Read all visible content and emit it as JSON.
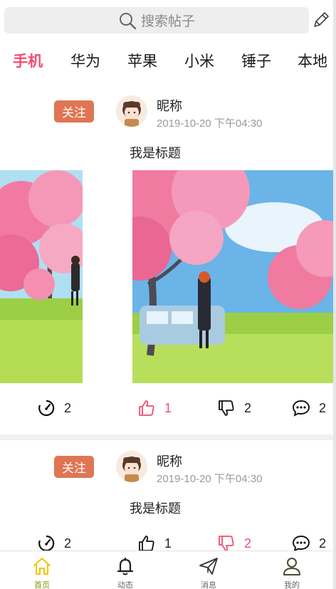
{
  "search": {
    "placeholder": "搜索帖子"
  },
  "tabs": [
    {
      "label": "手机",
      "active": true
    },
    {
      "label": "华为",
      "active": false
    },
    {
      "label": "苹果",
      "active": false
    },
    {
      "label": "小米",
      "active": false
    },
    {
      "label": "锤子",
      "active": false
    },
    {
      "label": "本地",
      "active": false
    }
  ],
  "posts": [
    {
      "follow_label": "关注",
      "nickname": "昵称",
      "time": "2019-10-20 下午04:30",
      "title": "我是标题",
      "actions": {
        "views": "2",
        "likes": "1",
        "dislikes": "2",
        "comments": "2"
      },
      "liked": true,
      "disliked": false
    },
    {
      "follow_label": "关注",
      "nickname": "昵称",
      "time": "2019-10-20 下午04:30",
      "title": "我是标题",
      "actions": {
        "views": "2",
        "likes": "1",
        "dislikes": "2",
        "comments": "2"
      },
      "liked": false,
      "disliked": true
    }
  ],
  "bottom_nav": [
    {
      "label": "首页",
      "icon": "home-icon",
      "active": true
    },
    {
      "label": "动态",
      "icon": "bell-icon",
      "active": false
    },
    {
      "label": "消息",
      "icon": "paper-plane-icon",
      "active": false
    },
    {
      "label": "我的",
      "icon": "user-icon",
      "active": false
    }
  ],
  "colors": {
    "accent": "#f24d70",
    "follow_button": "#e07553",
    "nav_active": "#f5c400",
    "search_bg": "#eeeeee"
  }
}
